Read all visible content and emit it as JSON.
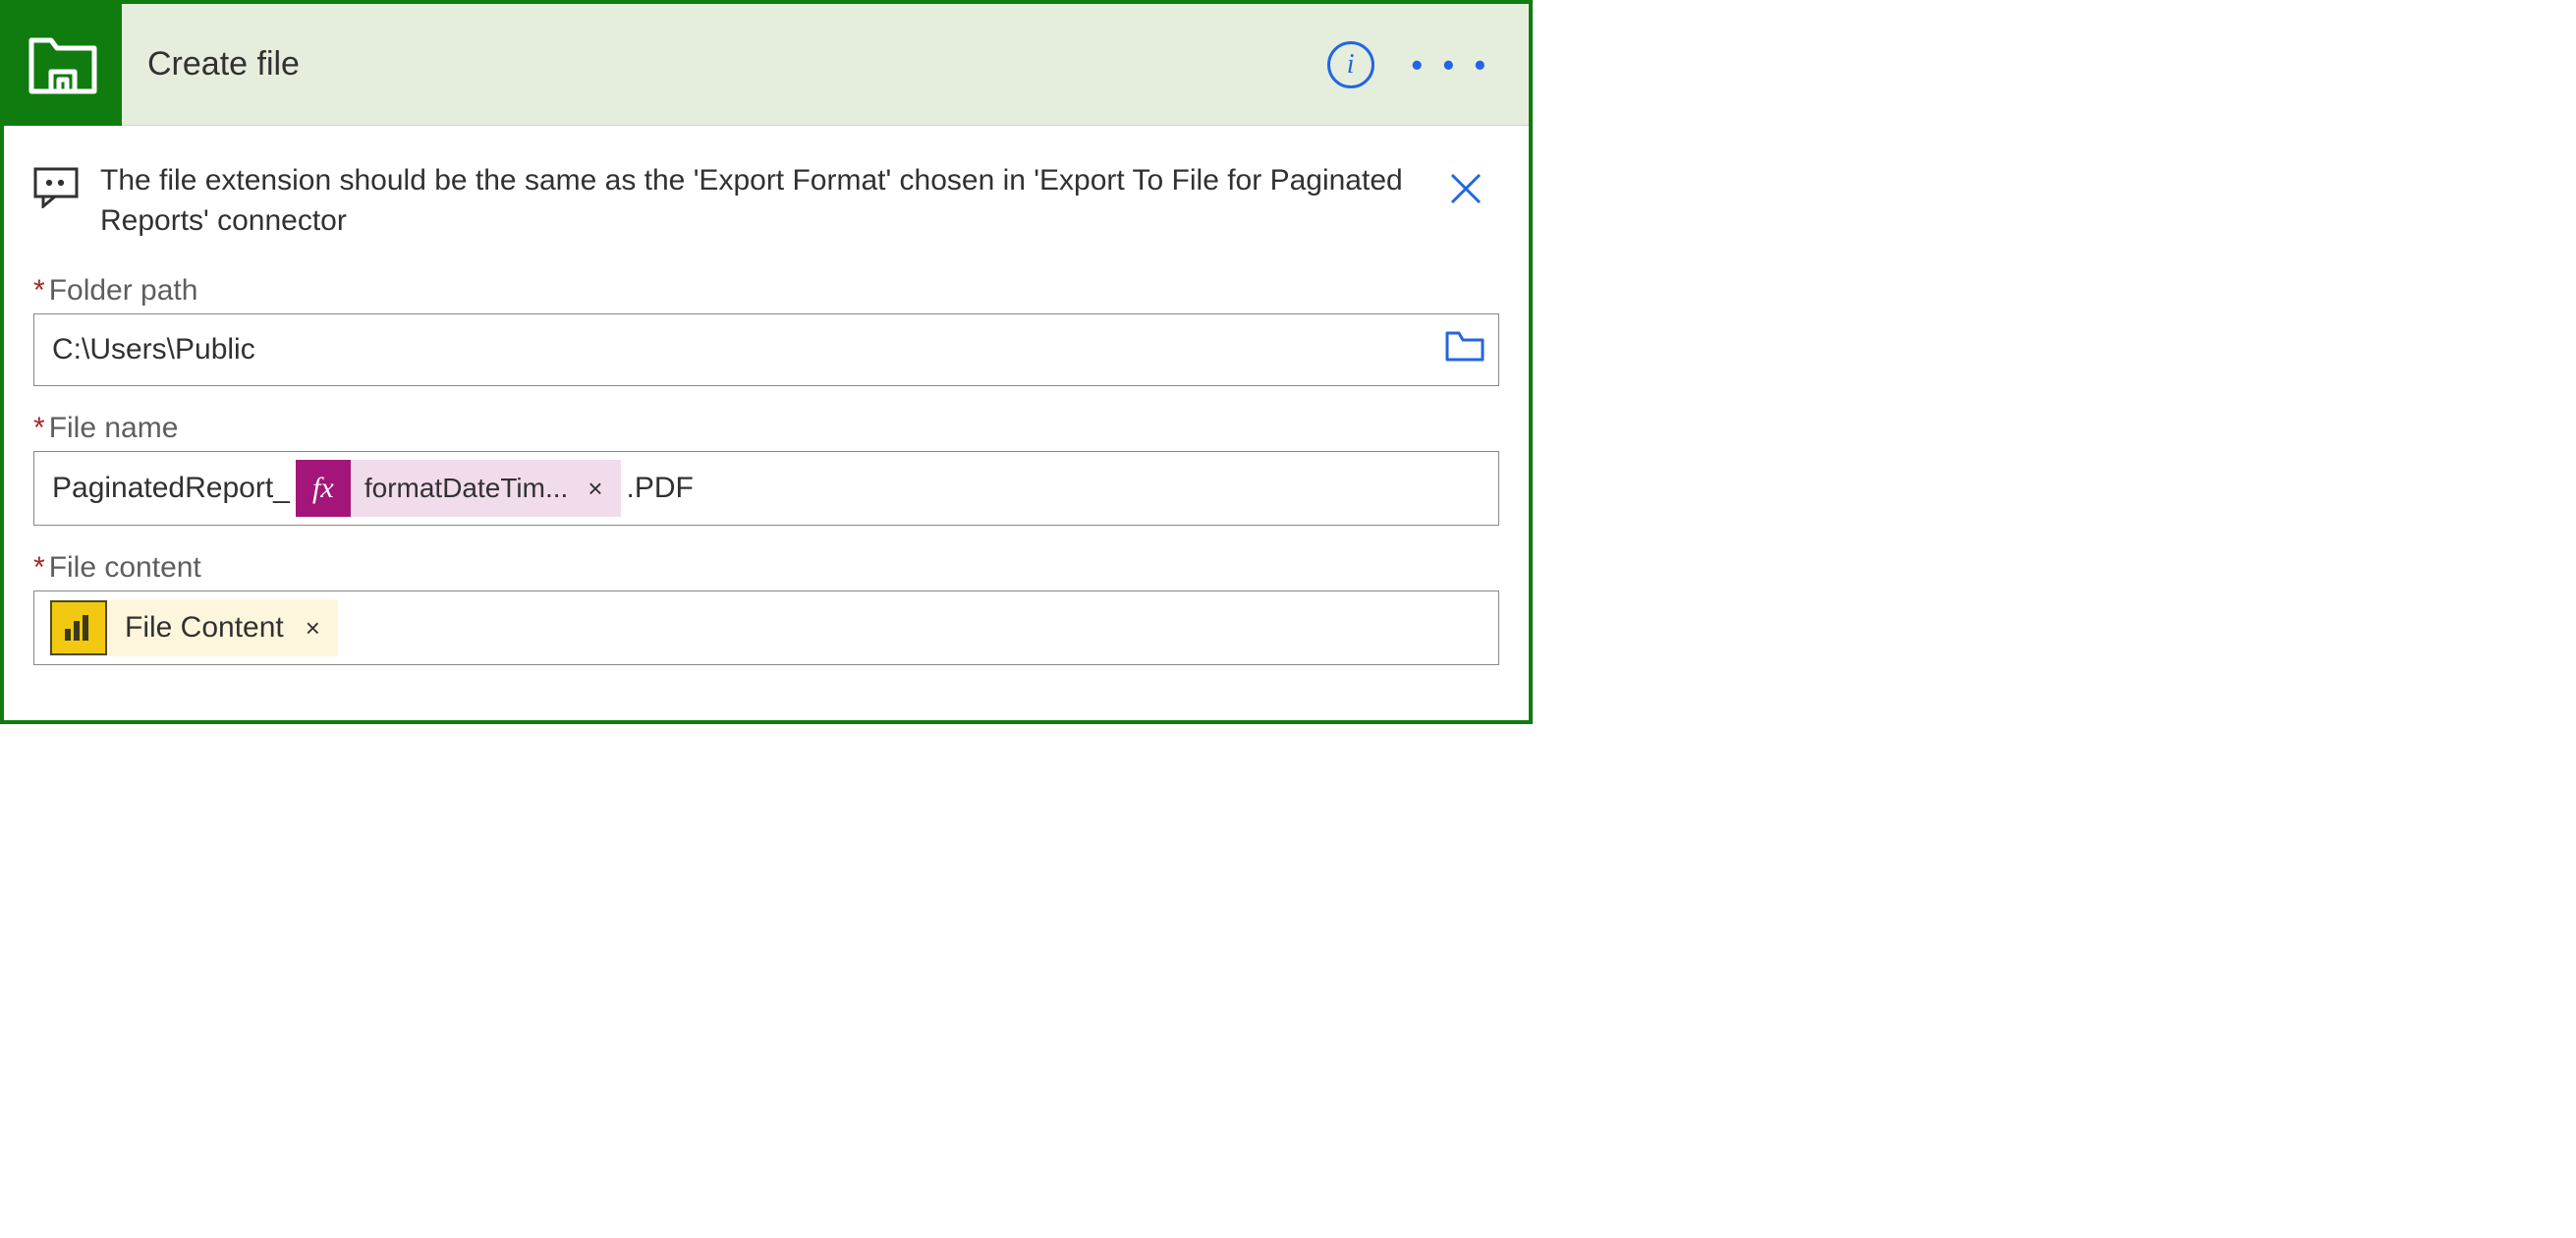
{
  "header": {
    "title": "Create file",
    "info_label": "i",
    "more_label": "• • •"
  },
  "comment": {
    "text": "The file extension should be the same as the 'Export Format' chosen in 'Export To File for Paginated Reports' connector"
  },
  "fields": {
    "folder_path": {
      "label": "Folder path",
      "value": "C:\\Users\\Public"
    },
    "file_name": {
      "label": "File name",
      "prefix": "PaginatedReport_",
      "expression_token": "formatDateTim...",
      "suffix": ".PDF"
    },
    "file_content": {
      "label": "File content",
      "token_label": "File Content"
    }
  },
  "icons": {
    "fx": "fx",
    "token_remove": "×"
  }
}
